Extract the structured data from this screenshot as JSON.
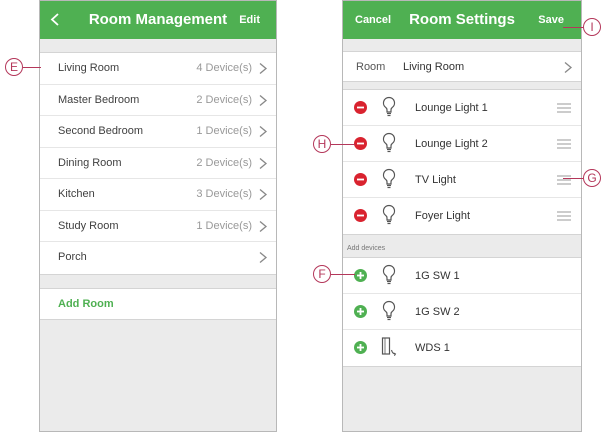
{
  "left_screen": {
    "header": {
      "title": "Room Management",
      "edit_label": "Edit",
      "back_icon": "chevron-left-icon"
    },
    "rooms": [
      {
        "name": "Living Room",
        "count": "4 Device(s)"
      },
      {
        "name": "Master Bedroom",
        "count": "2 Device(s)"
      },
      {
        "name": "Second Bedroom",
        "count": "1 Device(s)"
      },
      {
        "name": "Dining Room",
        "count": "2 Device(s)"
      },
      {
        "name": "Kitchen",
        "count": "3 Device(s)"
      },
      {
        "name": "Study Room",
        "count": "1 Device(s)"
      },
      {
        "name": "Porch",
        "count": ""
      }
    ],
    "add_room_label": "Add Room"
  },
  "right_screen": {
    "header": {
      "title": "Room Settings",
      "cancel_label": "Cancel",
      "save_label": "Save"
    },
    "room": {
      "label": "Room",
      "value": "Living Room"
    },
    "devices": [
      {
        "name": "Lounge Light 1",
        "icon": "bulb-icon"
      },
      {
        "name": "Lounge Light 2",
        "icon": "bulb-icon"
      },
      {
        "name": "TV Light",
        "icon": "bulb-icon"
      },
      {
        "name": "Foyer Light",
        "icon": "bulb-icon"
      }
    ],
    "add_devices_label": "Add devices",
    "available_devices": [
      {
        "name": "1G SW 1",
        "icon": "bulb-icon"
      },
      {
        "name": "1G SW 2",
        "icon": "bulb-icon"
      },
      {
        "name": "WDS 1",
        "icon": "window-door-sensor-icon"
      }
    ]
  },
  "callouts": {
    "e": "E",
    "f": "F",
    "g": "G",
    "h": "H",
    "i": "I"
  },
  "colors": {
    "header_green": "#4fb052",
    "remove_red": "#d9232f",
    "add_green": "#4fb052",
    "callout": "#b4375a"
  }
}
